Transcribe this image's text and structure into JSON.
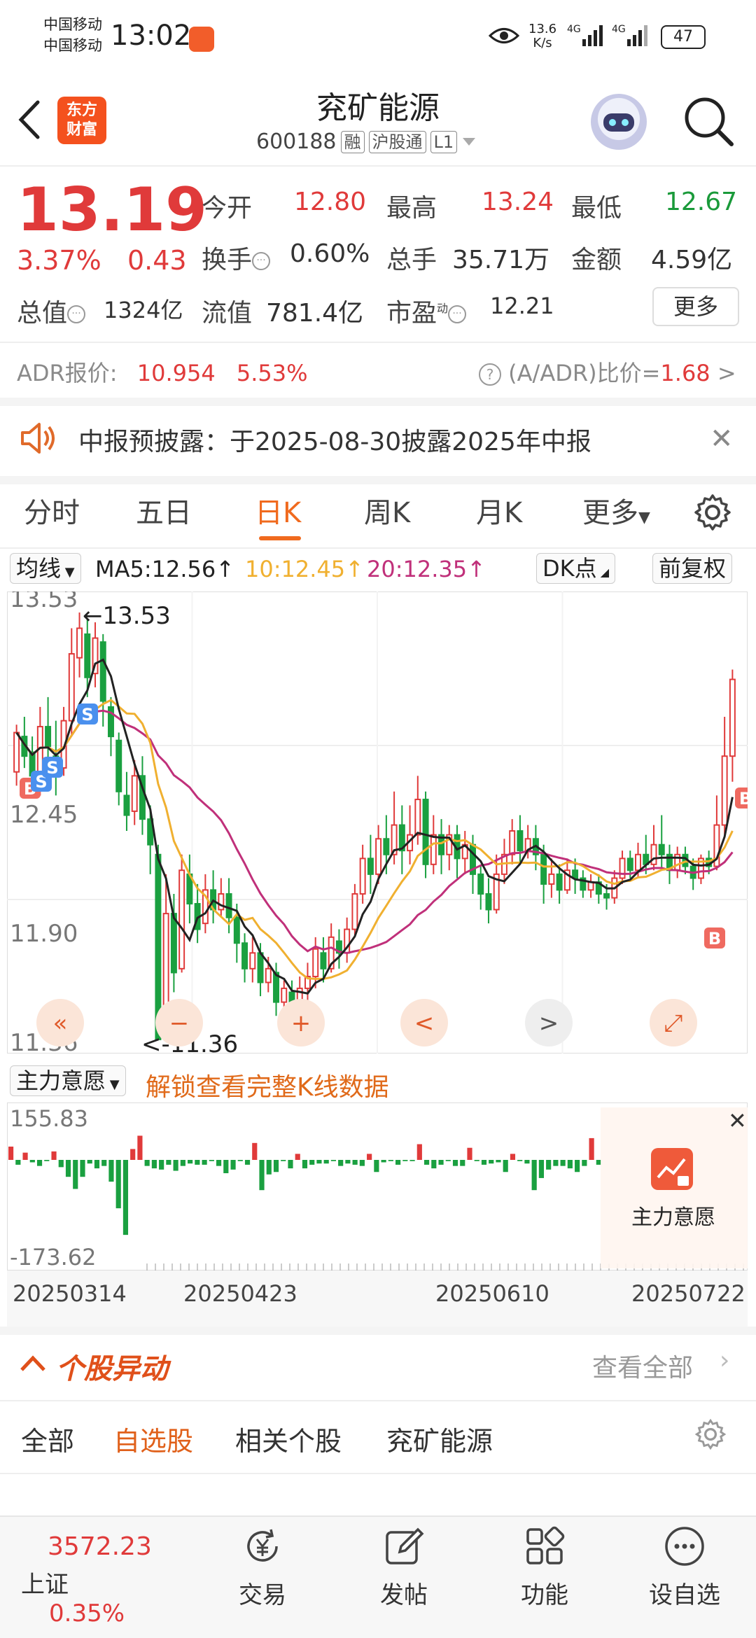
{
  "status_bar": {
    "carrier1": "中国移动",
    "carrier2": "中国移动",
    "time": "13:02",
    "net_speed_value": "13.6",
    "net_speed_unit": "K/s",
    "signal1": "4G",
    "signal2": "4G",
    "battery": "47"
  },
  "header": {
    "brand_line1": "东方",
    "brand_line2": "财富",
    "stock_name": "兖矿能源",
    "stock_code": "600188",
    "tags": [
      "融",
      "沪股通",
      "L1"
    ]
  },
  "quote": {
    "price": "13.19",
    "change_pct": "3.37%",
    "change": "0.43",
    "open_label": "今开",
    "open": "12.80",
    "high_label": "最高",
    "high": "13.24",
    "low_label": "最低",
    "low": "12.67",
    "turnover_label": "换手",
    "turnover": "0.60%",
    "volume_label": "总手",
    "volume": "35.71万",
    "amount_label": "金额",
    "amount": "4.59亿",
    "mktcap_label": "总值",
    "mktcap": "1324亿",
    "float_label": "流值",
    "float_cap": "781.4亿",
    "pe_label": "市盈",
    "pe_sup": "动",
    "pe": "12.21",
    "more_button": "更多"
  },
  "adr": {
    "label": "ADR报价:",
    "price": "10.954",
    "pct": "5.53%",
    "ratio_label": "(A/ADR)比价=",
    "ratio": "1.68"
  },
  "notice": {
    "text": "中报预披露：于2025-08-30披露2025年中报"
  },
  "tabs": [
    {
      "label": "分时"
    },
    {
      "label": "五日"
    },
    {
      "label": "日K"
    },
    {
      "label": "周K"
    },
    {
      "label": "月K"
    },
    {
      "label": "更多"
    }
  ],
  "ma_row": {
    "selector": "均线",
    "ma5": "MA5:12.56↑",
    "ma10": "10:12.45↑",
    "ma20": "20:12.35↑",
    "dk_button": "DK点",
    "adjust_button": "前复权",
    "ma5_color": "#222222",
    "ma10_color": "#f0b030",
    "ma20_color": "#c0307a"
  },
  "chart_data": {
    "type": "candlestick",
    "y_ticks": [
      "13.53",
      "12.45",
      "11.90",
      "11.36"
    ],
    "max_annotation": "←13.53",
    "min_annotation": "<-11.36",
    "candles": [
      [
        12.72,
        12.92,
        12.65,
        12.96
      ],
      [
        12.9,
        12.8,
        12.74,
        13.0
      ],
      [
        12.82,
        12.7,
        12.62,
        12.9
      ],
      [
        12.68,
        12.95,
        12.6,
        13.05
      ],
      [
        12.95,
        12.85,
        12.7,
        13.1
      ],
      [
        12.8,
        12.72,
        12.6,
        12.98
      ],
      [
        12.74,
        12.98,
        12.7,
        13.05
      ],
      [
        12.98,
        13.32,
        12.9,
        13.45
      ],
      [
        13.3,
        13.45,
        13.2,
        13.53
      ],
      [
        13.42,
        13.2,
        13.1,
        13.5
      ],
      [
        13.22,
        13.4,
        13.15,
        13.48
      ],
      [
        13.38,
        13.08,
        12.95,
        13.42
      ],
      [
        13.05,
        12.9,
        12.8,
        13.1
      ],
      [
        12.88,
        12.62,
        12.55,
        12.92
      ],
      [
        12.6,
        12.5,
        12.42,
        12.72
      ],
      [
        12.52,
        12.7,
        12.45,
        12.78
      ],
      [
        12.7,
        12.48,
        12.4,
        12.8
      ],
      [
        12.48,
        12.35,
        12.2,
        12.55
      ],
      [
        12.3,
        11.36,
        11.36,
        12.35
      ],
      [
        11.4,
        12.0,
        11.36,
        12.2
      ],
      [
        12.0,
        11.7,
        11.6,
        12.1
      ],
      [
        11.72,
        12.22,
        11.7,
        12.3
      ],
      [
        12.2,
        12.05,
        11.95,
        12.3
      ],
      [
        12.05,
        11.92,
        11.85,
        12.15
      ],
      [
        11.95,
        12.12,
        11.9,
        12.2
      ],
      [
        12.12,
        12.02,
        11.95,
        12.22
      ],
      [
        12.02,
        12.1,
        11.98,
        12.18
      ],
      [
        12.1,
        11.98,
        11.9,
        12.18
      ],
      [
        11.98,
        11.85,
        11.75,
        12.05
      ],
      [
        11.85,
        11.72,
        11.65,
        11.9
      ],
      [
        11.72,
        11.8,
        11.65,
        11.88
      ],
      [
        11.8,
        11.65,
        11.58,
        11.85
      ],
      [
        11.65,
        11.72,
        11.6,
        11.78
      ],
      [
        11.7,
        11.55,
        11.48,
        11.75
      ],
      [
        11.55,
        11.62,
        11.5,
        11.66
      ],
      [
        11.6,
        11.5,
        11.45,
        11.66
      ],
      [
        11.5,
        11.62,
        11.48,
        11.68
      ],
      [
        11.62,
        11.68,
        11.55,
        11.75
      ],
      [
        11.68,
        11.82,
        11.62,
        11.88
      ],
      [
        11.8,
        11.72,
        11.65,
        11.88
      ],
      [
        11.72,
        11.88,
        11.7,
        11.95
      ],
      [
        11.86,
        11.8,
        11.72,
        11.92
      ],
      [
        11.8,
        11.92,
        11.75,
        11.98
      ],
      [
        11.92,
        12.1,
        11.88,
        12.15
      ],
      [
        12.1,
        12.28,
        12.05,
        12.35
      ],
      [
        12.28,
        12.2,
        12.1,
        12.4
      ],
      [
        12.2,
        12.38,
        12.15,
        12.45
      ],
      [
        12.38,
        12.3,
        12.2,
        12.5
      ],
      [
        12.3,
        12.45,
        12.25,
        12.62
      ],
      [
        12.45,
        12.32,
        12.2,
        12.55
      ],
      [
        12.32,
        12.4,
        12.25,
        12.55
      ],
      [
        12.4,
        12.58,
        12.35,
        12.7
      ],
      [
        12.58,
        12.25,
        12.18,
        12.62
      ],
      [
        12.25,
        12.4,
        12.2,
        12.5
      ],
      [
        12.4,
        12.3,
        12.2,
        12.48
      ],
      [
        12.3,
        12.4,
        12.22,
        12.45
      ],
      [
        12.4,
        12.28,
        12.18,
        12.45
      ],
      [
        12.28,
        12.35,
        12.2,
        12.42
      ],
      [
        12.35,
        12.2,
        12.1,
        12.4
      ],
      [
        12.2,
        12.1,
        12.02,
        12.25
      ],
      [
        12.1,
        12.02,
        11.95,
        12.18
      ],
      [
        12.02,
        12.2,
        12.0,
        12.3
      ],
      [
        12.2,
        12.3,
        12.15,
        12.38
      ],
      [
        12.3,
        12.42,
        12.25,
        12.48
      ],
      [
        12.42,
        12.32,
        12.25,
        12.5
      ],
      [
        12.32,
        12.38,
        12.28,
        12.45
      ],
      [
        12.38,
        12.3,
        12.22,
        12.45
      ],
      [
        12.3,
        12.15,
        12.05,
        12.35
      ],
      [
        12.15,
        12.2,
        12.08,
        12.28
      ],
      [
        12.2,
        12.12,
        12.05,
        12.25
      ],
      [
        12.12,
        12.22,
        12.1,
        12.28
      ],
      [
        12.22,
        12.18,
        12.1,
        12.28
      ],
      [
        12.18,
        12.12,
        12.08,
        12.22
      ],
      [
        12.12,
        12.16,
        12.08,
        12.2
      ],
      [
        12.16,
        12.1,
        12.05,
        12.2
      ],
      [
        12.1,
        12.08,
        12.02,
        12.15
      ],
      [
        12.08,
        12.18,
        12.05,
        12.22
      ],
      [
        12.18,
        12.28,
        12.15,
        12.32
      ],
      [
        12.28,
        12.22,
        12.18,
        12.32
      ],
      [
        12.22,
        12.3,
        12.18,
        12.36
      ],
      [
        12.3,
        12.25,
        12.2,
        12.4
      ],
      [
        12.25,
        12.35,
        12.22,
        12.45
      ],
      [
        12.35,
        12.3,
        12.22,
        12.5
      ],
      [
        12.3,
        12.22,
        12.15,
        12.35
      ],
      [
        12.22,
        12.3,
        12.18,
        12.34
      ],
      [
        12.3,
        12.24,
        12.2,
        12.34
      ],
      [
        12.24,
        12.18,
        12.12,
        12.28
      ],
      [
        12.18,
        12.28,
        12.15,
        12.3
      ],
      [
        12.28,
        12.24,
        12.2,
        12.32
      ],
      [
        12.24,
        12.45,
        12.22,
        12.6
      ],
      [
        12.45,
        12.8,
        12.4,
        13.0
      ],
      [
        12.8,
        13.19,
        12.67,
        13.24
      ]
    ],
    "ma5_label": "MA5",
    "ma10_label": "MA10",
    "ma20_label": "MA20",
    "volume_panel": {
      "ytop": "155.83",
      "ybot": "-173.62",
      "dates": [
        "20250314",
        "20250423",
        "20250610",
        "20250722"
      ]
    }
  },
  "zoom_controls": [
    "«",
    "−",
    "+",
    "<",
    ">",
    "⤢"
  ],
  "force_row": {
    "selector": "主力意愿",
    "unlock_text": "解锁查看完整K线数据",
    "badge_label": "主力意愿"
  },
  "movers": {
    "title": "个股异动",
    "view_all": "查看全部",
    "subtabs": [
      "全部",
      "自选股",
      "相关个股",
      "兖矿能源"
    ]
  },
  "bottom_nav": {
    "index_value": "3572.23",
    "index_name": "上证",
    "index_pct": "0.35%",
    "items": [
      {
        "label": "交易"
      },
      {
        "label": "发帖"
      },
      {
        "label": "功能"
      },
      {
        "label": "设自选"
      }
    ]
  }
}
